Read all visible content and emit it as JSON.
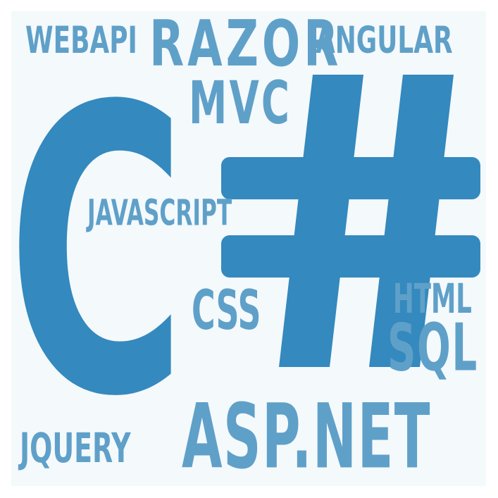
{
  "words": {
    "webapi": "WEBAPI",
    "razor": "RAZOR",
    "angular": "ANGULAR",
    "mvc": "MVC",
    "c_letter": "C",
    "javascript": "JAVASCRIPT",
    "css": "CSS",
    "html": "HTML",
    "sql": "SQL",
    "jquery": "JQUERY",
    "aspnet": "ASP.NET"
  },
  "hash_symbol": "#",
  "colors": {
    "primary": "#3489be",
    "secondary": "#5fa0c9",
    "background": "#f4f9fb"
  }
}
